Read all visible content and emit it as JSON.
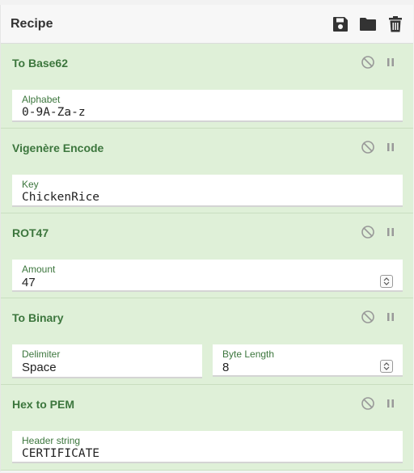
{
  "header": {
    "title": "Recipe",
    "icons": [
      "save-icon",
      "folder-icon",
      "trash-icon"
    ]
  },
  "operations": [
    {
      "title": "To Base62",
      "fields": [
        {
          "label": "Alphabet",
          "value": "0-9A-Za-z"
        }
      ]
    },
    {
      "title": "Vigenère Encode",
      "fields": [
        {
          "label": "Key",
          "value": "ChickenRice"
        }
      ]
    },
    {
      "title": "ROT47",
      "fields": [
        {
          "label": "Amount",
          "value": "47"
        }
      ]
    },
    {
      "title": "To Binary",
      "fields": [
        {
          "label": "Delimiter",
          "value": "Space"
        },
        {
          "label": "Byte Length",
          "value": "8"
        }
      ]
    },
    {
      "title": "Hex to PEM",
      "fields": [
        {
          "label": "Header string",
          "value": "CERTIFICATE"
        }
      ]
    }
  ],
  "colors": {
    "op_background": "#dff0d8",
    "op_title": "#3c763d",
    "header_background": "#f7f7f7"
  }
}
